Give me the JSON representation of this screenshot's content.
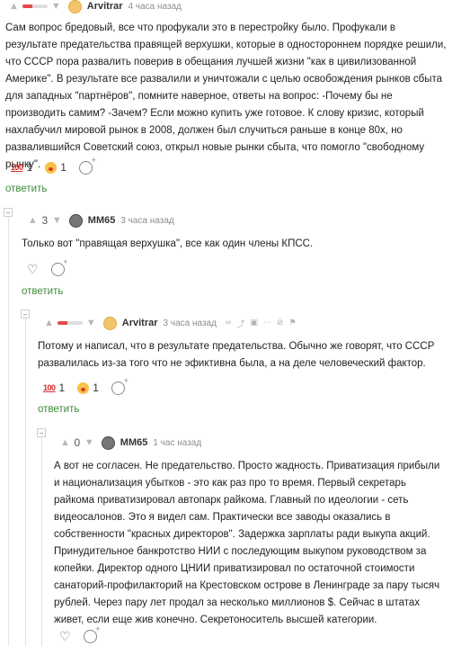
{
  "comments": [
    {
      "author": "Arvitrar",
      "time": "4 часа назад",
      "score": "",
      "text": "Сам вопрос бредовый, все что профукали это в перестройку было. Профукали в результате предательства правящей верхушки, которые в одностороннем порядке решили, что СССР пора развалить поверив в обещания лучшей жизни \"как в цивилизованной Америке\". В результате все развалили и уничтожали с целью освобождения рынков сбыта для западных \"партнёров\", помните наверное, ответы на вопрос: -Почему бы не производить самим? -Зачем? Если можно купить уже готовое. К слову кризис, который нахлабучил мировой рынок в 2008, должен был случиться раньше в конце 80х, но развалившийся Советский союз, открыл новые рынки сбыта, что помогло \"свободному рынку\".",
      "reactions": [
        {
          "icon": "100-emoji",
          "label": "100",
          "count": "1"
        },
        {
          "icon": "clown-emoji",
          "count": "1"
        }
      ],
      "reply_label": "ответить"
    },
    {
      "author": "MM65",
      "time": "3 часа назад",
      "score": "3",
      "text": "Только вот \"правящая верхушка\", все как один члены КПСС.",
      "reply_label": "ответить"
    },
    {
      "author": "Arvitrar",
      "time": "3 часа назад",
      "score": "",
      "text": "Потому и написал, что в результате предательства. Обычно же говорят, что СССР развалилась из-за того что не эфиктивна была, а на деле человеческий фактор.",
      "reactions": [
        {
          "icon": "100-emoji",
          "label": "100",
          "count": "1"
        },
        {
          "icon": "clown-emoji",
          "count": "1"
        }
      ],
      "reply_label": "ответить"
    },
    {
      "author": "MM65",
      "time": "1 час назад",
      "score": "0",
      "text": "А вот не согласен. Не предательство. Просто жадность. Приватизация прибыли и национализация убытков - это как раз про то время. Первый секретарь райкома приватизировал автопарк райкома. Главный по идеологии - сеть видеосалонов. Это я видел сам. Практически все заводы оказались в собственности \"красных директоров\". Задержка зарплаты ради выкупа акций. Принудительное банкротство НИИ с последующим выкупом руководством за копейки. Директор одного ЦНИИ приватизировал по остаточной стоимости санаторий-профилакторий на Крестовском острове в Ленинграде за пару тысяч рублей. Через пару лет продал за несколько миллионов $. Сейчас в штатах живет, если еще жив конечно. Секретоноситель высшей категории."
    }
  ],
  "colors": {
    "reply": "#3d8a38",
    "negative": "#e04a4a",
    "avatar_arvitrar": "#f2c56a"
  }
}
